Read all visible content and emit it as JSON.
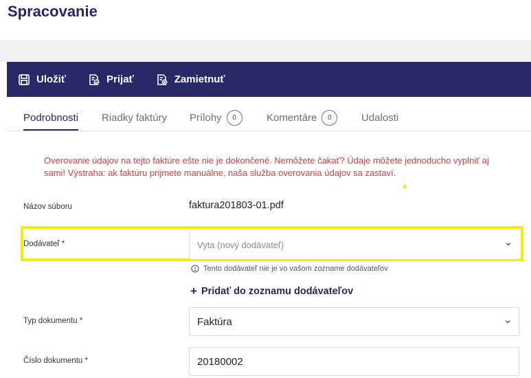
{
  "header": {
    "title": "Spracovanie"
  },
  "toolbar": {
    "save_label": "Uložiť",
    "accept_label": "Prijať",
    "reject_label": "Zamietnuť"
  },
  "tabs": [
    {
      "label": "Podrobnosti",
      "active": true
    },
    {
      "label": "Riadky faktúry"
    },
    {
      "label": "Prílohy",
      "count": "0"
    },
    {
      "label": "Komentáre",
      "count": "0"
    },
    {
      "label": "Udalosti"
    }
  ],
  "warning": "Overovanie údajov na tejto faktúre ešte nie je dokončené. Nemôžete čakať? Údaje môžete jednoducho vyplniť aj sami! Výstraha: ak faktúru prijmete manuálne, naša služba overovania údajov sa zastaví.",
  "form": {
    "file_name": {
      "label": "Názov súboru",
      "value": "faktura201803-01.pdf"
    },
    "supplier": {
      "label": "Dodávateľ *",
      "placeholder": "Vyta (nový dodávateľ)",
      "note": "Tento dodávateľ nie je vo vašom zozname dodávateľov",
      "add_link": "Pridať do zoznamu dodávateľov"
    },
    "doc_type": {
      "label": "Typ dokumentu *",
      "value": "Faktúra"
    },
    "doc_number": {
      "label": "Číslo dokumentu *",
      "value": "20180002"
    }
  },
  "colors": {
    "brand": "#2b2868",
    "warning": "#d83a3a",
    "highlight": "#f4ec0c"
  }
}
